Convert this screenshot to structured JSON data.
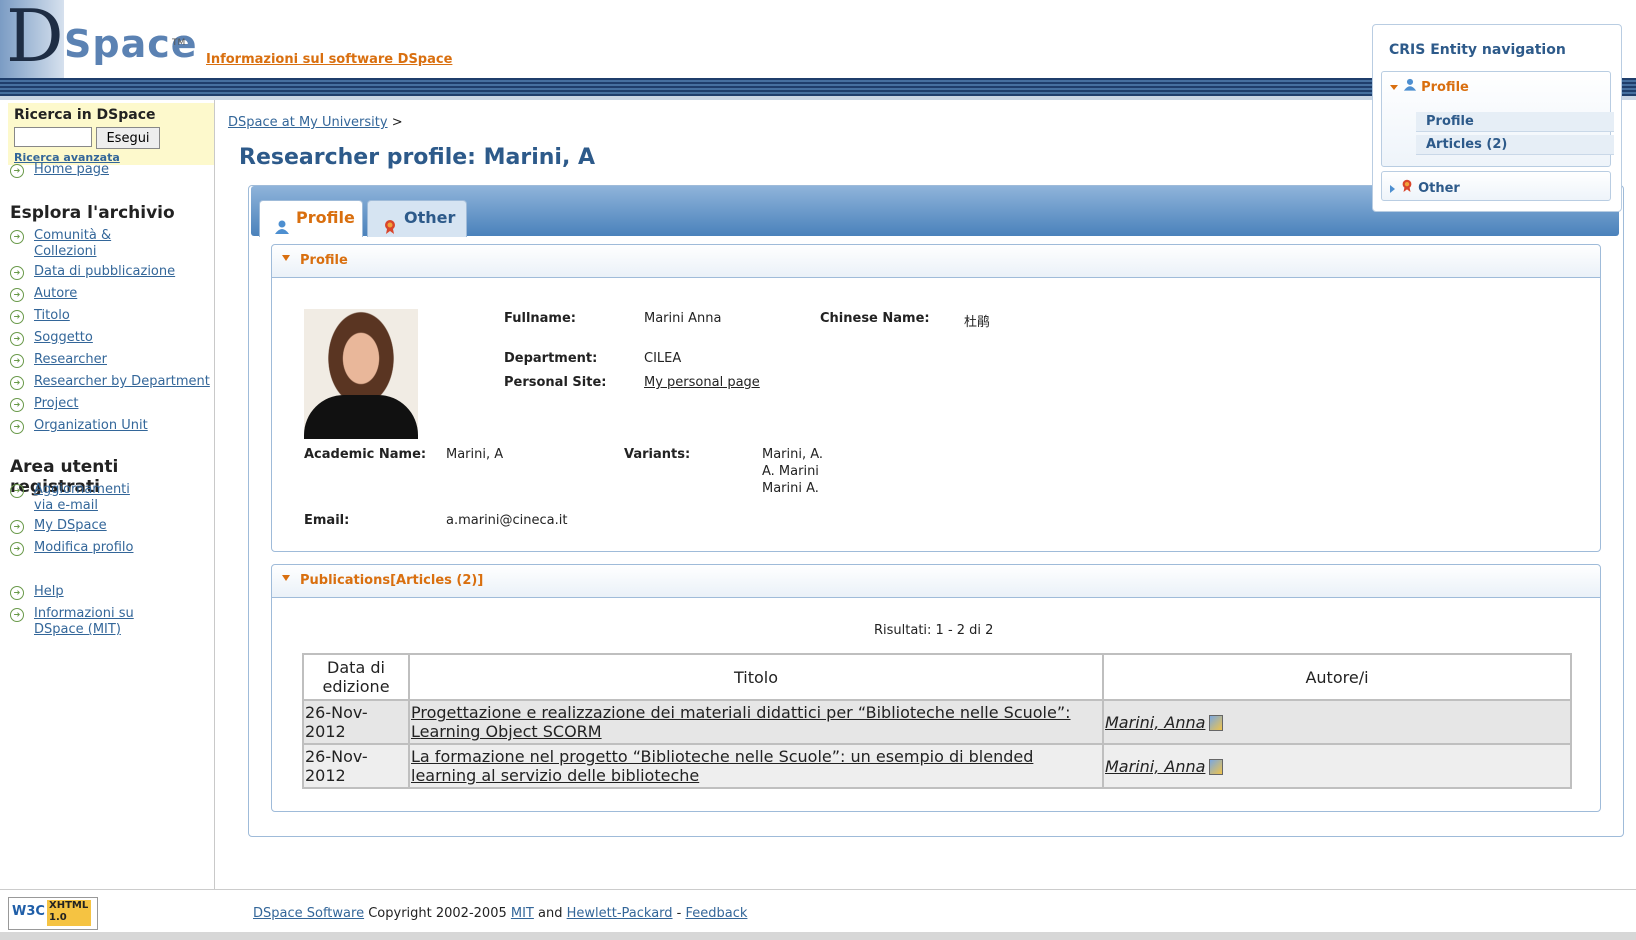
{
  "header": {
    "logo_d": "D",
    "logo_space": "Space",
    "logo_tm": "TM",
    "about_link": "Informazioni sul software DSpace"
  },
  "sidebar": {
    "search_title": "Ricerca in DSpace",
    "search_button": "Esegui",
    "advanced_search": "Ricerca avanzata",
    "home": "Home page",
    "browse_heading": "Esplora l'archivio",
    "browse_items": [
      "Comunità & Collezioni",
      "Data di pubblicazione",
      "Autore",
      "Titolo",
      "Soggetto",
      "Researcher",
      "Researcher by Department",
      "Project",
      "Organization Unit"
    ],
    "user_heading": "Area utenti registrati",
    "user_items": [
      "Aggiornamenti via e-mail",
      "My DSpace",
      "Modifica profilo"
    ],
    "help_items": [
      "Help",
      "Informazioni su DSpace (MIT)"
    ]
  },
  "breadcrumb": {
    "link": "DSpace at My University",
    "sep": ">"
  },
  "page_title": "Researcher profile: Marini, A",
  "tabs": [
    {
      "label": "Profile",
      "active": true
    },
    {
      "label": "Other",
      "active": false
    }
  ],
  "profile_panel": {
    "title": "Profile",
    "fields": {
      "fullname_label": "Fullname:",
      "fullname": "Marini Anna",
      "chinese_label": "Chinese Name:",
      "chinese": "杜鹃",
      "department_label": "Department:",
      "department": "CILEA",
      "site_label": "Personal Site:",
      "site": "My personal page",
      "academic_label": "Academic Name:",
      "academic": "Marini, A",
      "variants_label": "Variants:",
      "variants": [
        "Marini, A.",
        "A. Marini",
        "Marini A."
      ],
      "email_label": "Email:",
      "email": "a.marini@cineca.it"
    }
  },
  "publications_panel": {
    "title": "Publications[Articles (2)]",
    "results": "Risultati: 1 - 2 di 2",
    "columns": [
      "Data di edizione",
      "Titolo",
      "Autore/i"
    ],
    "rows": [
      {
        "date": "26-Nov-2012",
        "title": "Progettazione e realizzazione dei materiali didattici per “Biblioteche nelle Scuole”: Learning Object SCORM",
        "author": "Marini, Anna"
      },
      {
        "date": "26-Nov-2012",
        "title": "La formazione nel progetto “Biblioteche nelle Scuole”: un esempio di blended learning al servizio delle biblioteche",
        "author": "Marini, Anna"
      }
    ]
  },
  "cris_nav": {
    "title": "CRIS Entity navigation",
    "groups": [
      {
        "label": "Profile",
        "items": [
          "Profile",
          "Articles (2)"
        ]
      },
      {
        "label": "Other",
        "items": []
      }
    ]
  },
  "footer": {
    "w3c": "W3C",
    "xhtml": "XHTML 1.0",
    "software": "DSpace Software",
    "copyright": "Copyright 2002-2005",
    "mit": "MIT",
    "and": "and",
    "hp": "Hewlett-Packard",
    "dash": "-",
    "feedback": "Feedback"
  },
  "colors": {
    "accent": "#d96f0f",
    "link": "#336699",
    "title": "#2d5a8a"
  }
}
